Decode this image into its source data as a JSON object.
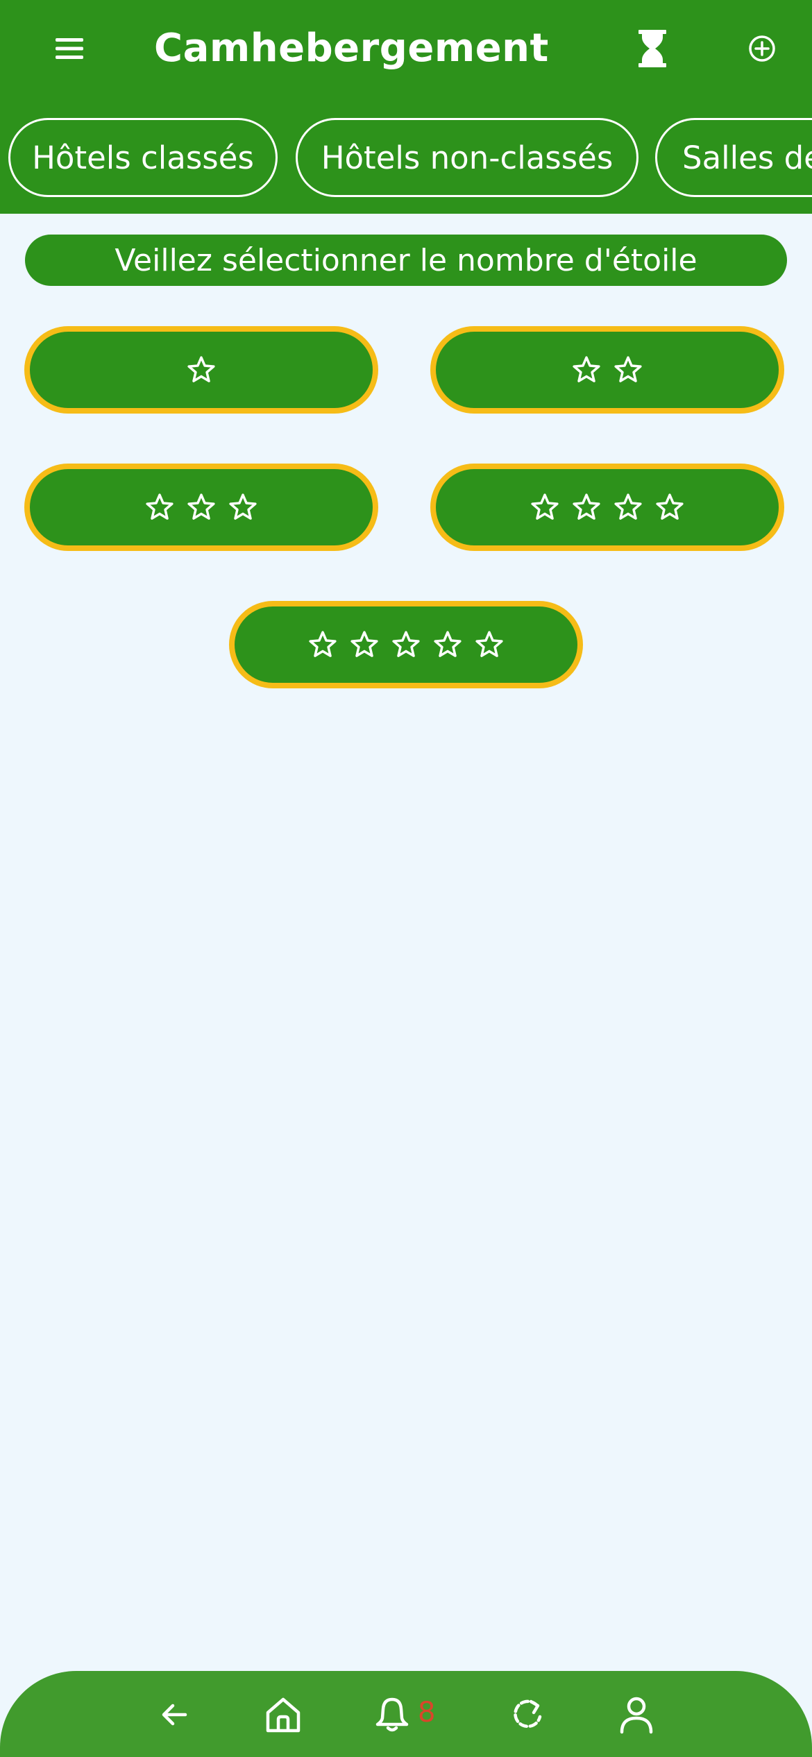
{
  "app": {
    "title": "Camhebergement"
  },
  "header": {
    "icons": {
      "menu": "menu-icon",
      "hourglass": "hourglass-icon",
      "add": "add-circle-icon"
    }
  },
  "tabs": [
    {
      "label": "Hôtels classés"
    },
    {
      "label": "Hôtels non-classés"
    },
    {
      "label": "Salles de"
    }
  ],
  "instruction": "Veillez sélectionner le nombre d'étoile",
  "star_options": [
    1,
    2,
    3,
    4,
    5
  ],
  "bottom_nav": {
    "items": [
      "back-arrow-icon",
      "home-icon",
      "bell-icon",
      "refresh-icon",
      "profile-icon"
    ],
    "notification_count": "8"
  },
  "colors": {
    "primary_green": "#2d921b",
    "nav_green": "#419b2d",
    "star_border": "#f6bc17",
    "background": "#eef7fd",
    "badge": "#d9462b"
  }
}
